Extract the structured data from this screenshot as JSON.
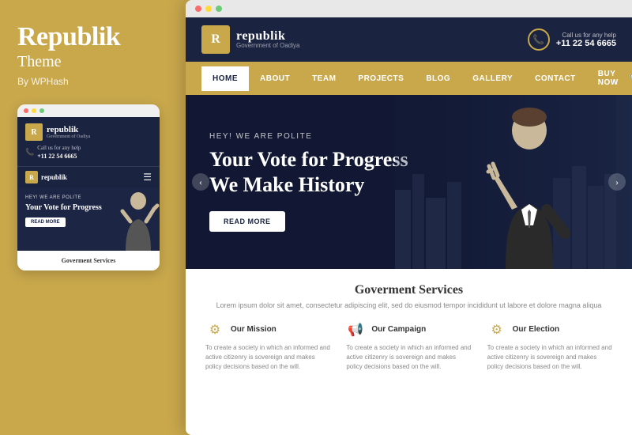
{
  "left": {
    "title": "Republik",
    "subtitle": "Theme",
    "by": "By WPHash"
  },
  "mobile": {
    "logo_letter": "R",
    "logo_name": "republik",
    "logo_sub": "Government of Oadiya",
    "phone_label": "Call us for any help",
    "phone_number": "+11 22 54 6665",
    "hero_tagline": "HEY! WE ARE POLITE",
    "hero_title": "Your Vote for Progress",
    "hero_cta": "READ MORE",
    "services_title": "Goverment Services"
  },
  "desktop": {
    "logo_letter": "R",
    "logo_name": "republik",
    "logo_sub": "Government of Oadiya",
    "phone_label": "Call us for any help",
    "phone_number": "+11 22 54 6665",
    "nav": [
      "HOME",
      "ABOUT",
      "TEAM",
      "PROJECTS",
      "BLOG",
      "GALLERY",
      "CONTACT",
      "BUY NOW"
    ],
    "hero_tagline": "HEY! WE ARE POLITE",
    "hero_line1": "Your Vote for Progress",
    "hero_line2": "We Make History",
    "hero_cta": "READ MORE",
    "services_title": "Goverment Services",
    "services_desc": "Lorem ipsum dolor sit amet, consectetur adipiscing elit, sed do eiusmod tempor\nincididunt ut labore et dolore magna aliqua",
    "service1_title": "Our Mission",
    "service1_desc": "To create a society in which an informed and active citizenry is sovereign and makes policy decisions based on the will.",
    "service2_title": "Our Campaign",
    "service2_desc": "To create a society in which an informed and active citizenry is sovereign and makes policy decisions based on the will.",
    "service3_title": "Our Election",
    "service3_desc": "To create a society in which an informed and active citizenry is sovereign and makes policy decisions based on the will."
  }
}
